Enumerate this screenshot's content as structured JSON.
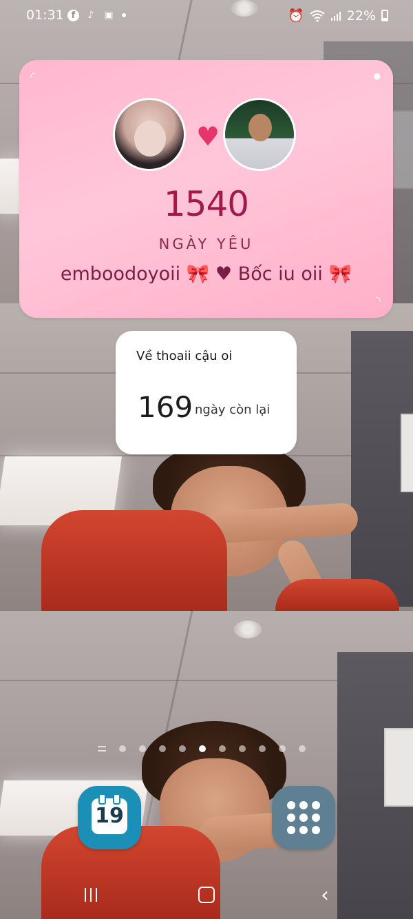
{
  "status_bar": {
    "time": "01:31",
    "notification_icons": [
      "facebook-icon",
      "tiktok-icon",
      "gallery-icon",
      "more-dot"
    ],
    "battery_percent": "22%",
    "system_icons": [
      "alarm-icon",
      "wifi-icon",
      "signal-icon",
      "battery-icon"
    ]
  },
  "love_widget": {
    "days_count": "1540",
    "days_label": "NGÀY YÊU",
    "couple_names": "emboodoyoii 🎀 ♥ Bốc iu oii 🎀",
    "heart_color": "#e8336b"
  },
  "countdown_widget": {
    "title": "Về thoaii cậu oi",
    "days_left": "169",
    "unit_label": "ngày còn lại"
  },
  "home": {
    "page_count": 10,
    "active_page": 5
  },
  "dock": {
    "calendar_day": "19",
    "calendar_color": "#1b8fb6",
    "apps_color": "#5f7f93"
  },
  "navigation": {
    "buttons": [
      "recents",
      "home",
      "back"
    ]
  }
}
